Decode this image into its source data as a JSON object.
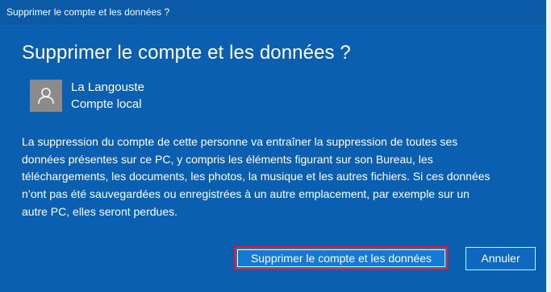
{
  "window": {
    "title": "Supprimer le compte et les données ?"
  },
  "dialog": {
    "heading": "Supprimer le compte et les données ?",
    "user": {
      "name": "La Langouste",
      "type": "Compte local",
      "avatar_icon": "person-icon"
    },
    "message_lines": [
      "La suppression du compte de cette personne va entraîner la suppression de toutes ses",
      "données présentes sur ce PC, y compris les éléments figurant sur son Bureau, les",
      "téléchargements, les documents, les photos, la musique et les autres fichiers. Si ces données",
      "n’ont pas été sauvegardées ou enregistrées à un autre emplacement, par exemple sur un",
      "autre PC, elles seront perdues."
    ],
    "buttons": {
      "delete_label": "Supprimer le compte et les données",
      "cancel_label": "Annuler"
    }
  },
  "colors": {
    "background": "#0b5fb0",
    "primary_button": "#1679d5",
    "highlight_border": "#e3172a"
  }
}
